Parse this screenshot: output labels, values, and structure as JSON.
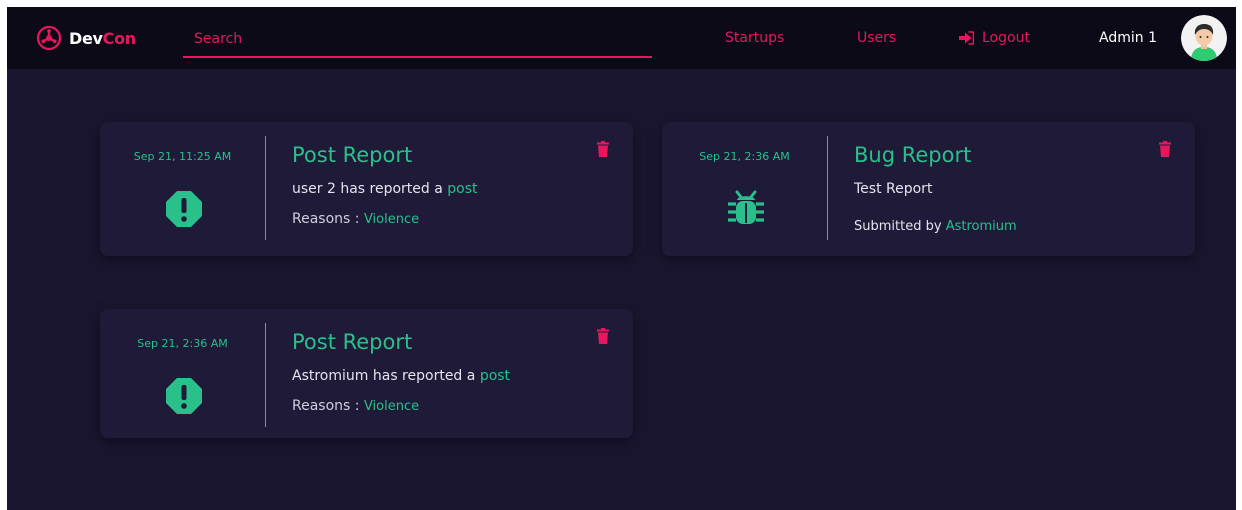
{
  "brand": {
    "dev": "Dev",
    "con": "Con",
    "logo_icon": "devcon-logo-icon"
  },
  "search": {
    "placeholder": "Search",
    "value": ""
  },
  "nav": {
    "startups": "Startups",
    "users": "Users",
    "logout": "Logout",
    "logout_icon": "sign-out-icon",
    "admin_name": "Admin 1"
  },
  "colors": {
    "accent_green": "#29c08b",
    "accent_pink": "#e8175d",
    "background": "#1a1631",
    "navbar": "#0c0a17",
    "card": "#1e1a38"
  },
  "reports": [
    {
      "type": "post",
      "date": "Sep 21, 11:25 AM",
      "title": "Post Report",
      "reporter_text": "user 2 has reported a",
      "link_text": "post",
      "reasons_label": "Reasons :",
      "reason": "Violence",
      "icon": "alert-octagon-icon"
    },
    {
      "type": "bug",
      "date": "Sep 21, 2:36 AM",
      "title": "Bug Report",
      "description": "Test Report",
      "submitted_label": "Submitted by",
      "submitter": "Astromium",
      "icon": "bug-icon"
    },
    {
      "type": "post",
      "date": "Sep 21, 2:36 AM",
      "title": "Post Report",
      "reporter_text": "Astromium has reported a",
      "link_text": "post",
      "reasons_label": "Reasons :",
      "reason": "Violence",
      "icon": "alert-octagon-icon"
    }
  ]
}
